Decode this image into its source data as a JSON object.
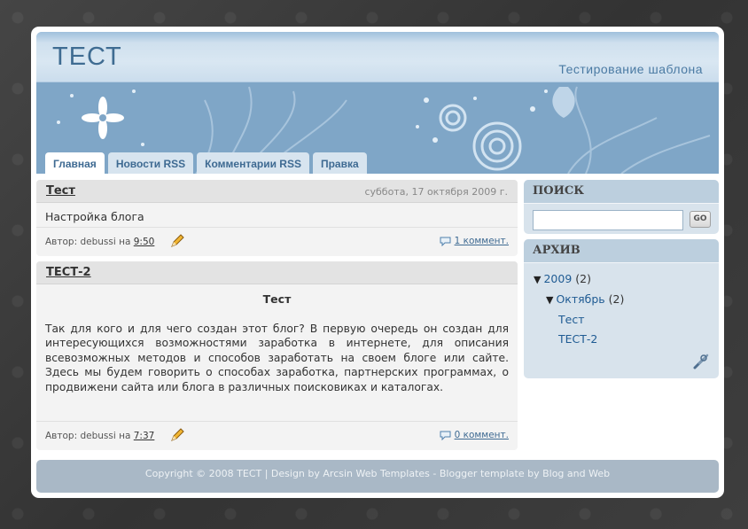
{
  "header": {
    "title": "ТЕСТ",
    "description": "Тестирование шаблона"
  },
  "tabs": [
    {
      "label": "Главная",
      "active": true
    },
    {
      "label": "Новости RSS",
      "active": false
    },
    {
      "label": "Комментарии RSS",
      "active": false
    },
    {
      "label": "Правка",
      "active": false
    }
  ],
  "posts": [
    {
      "title": "Тест",
      "date": "суббота, 17 октября 2009 г.",
      "body": "Настройка блога",
      "author_prefix": "Автор: debussi на",
      "time": "9:50",
      "comments": "1 коммент."
    },
    {
      "title": "ТЕСТ-2",
      "heading": "Тест",
      "body": "Так для кого и для чего создан этот блог? В первую очередь он создан для интересующихся возможностями заработка в интернете, для описания всевозможных методов и способов заработать на своем блоге или сайте. Здесь мы будем говорить о способах заработка, партнерских программах, о продвижени сайта или блога в различных поисковиках и каталогах.",
      "author_prefix": "Автор: debussi на",
      "time": "7:37",
      "comments": "0 коммент."
    }
  ],
  "sidebar": {
    "search": {
      "title": "ПОИСК",
      "value": "",
      "button": "GO"
    },
    "archive": {
      "title": "АРХИВ",
      "year": "2009",
      "year_count": "(2)",
      "month": "Октябрь",
      "month_count": "(2)",
      "items": [
        "Тест",
        "ТЕСТ-2"
      ]
    }
  },
  "footer": {
    "text": "Copyright © 2008 ТЕСТ | Design by Arcsin Web Templates - Blogger template by Blog and Web"
  },
  "colors": {
    "accent": "#3e6a92",
    "link": "#1f5b93",
    "footer_bg": "#a9b8c6"
  }
}
